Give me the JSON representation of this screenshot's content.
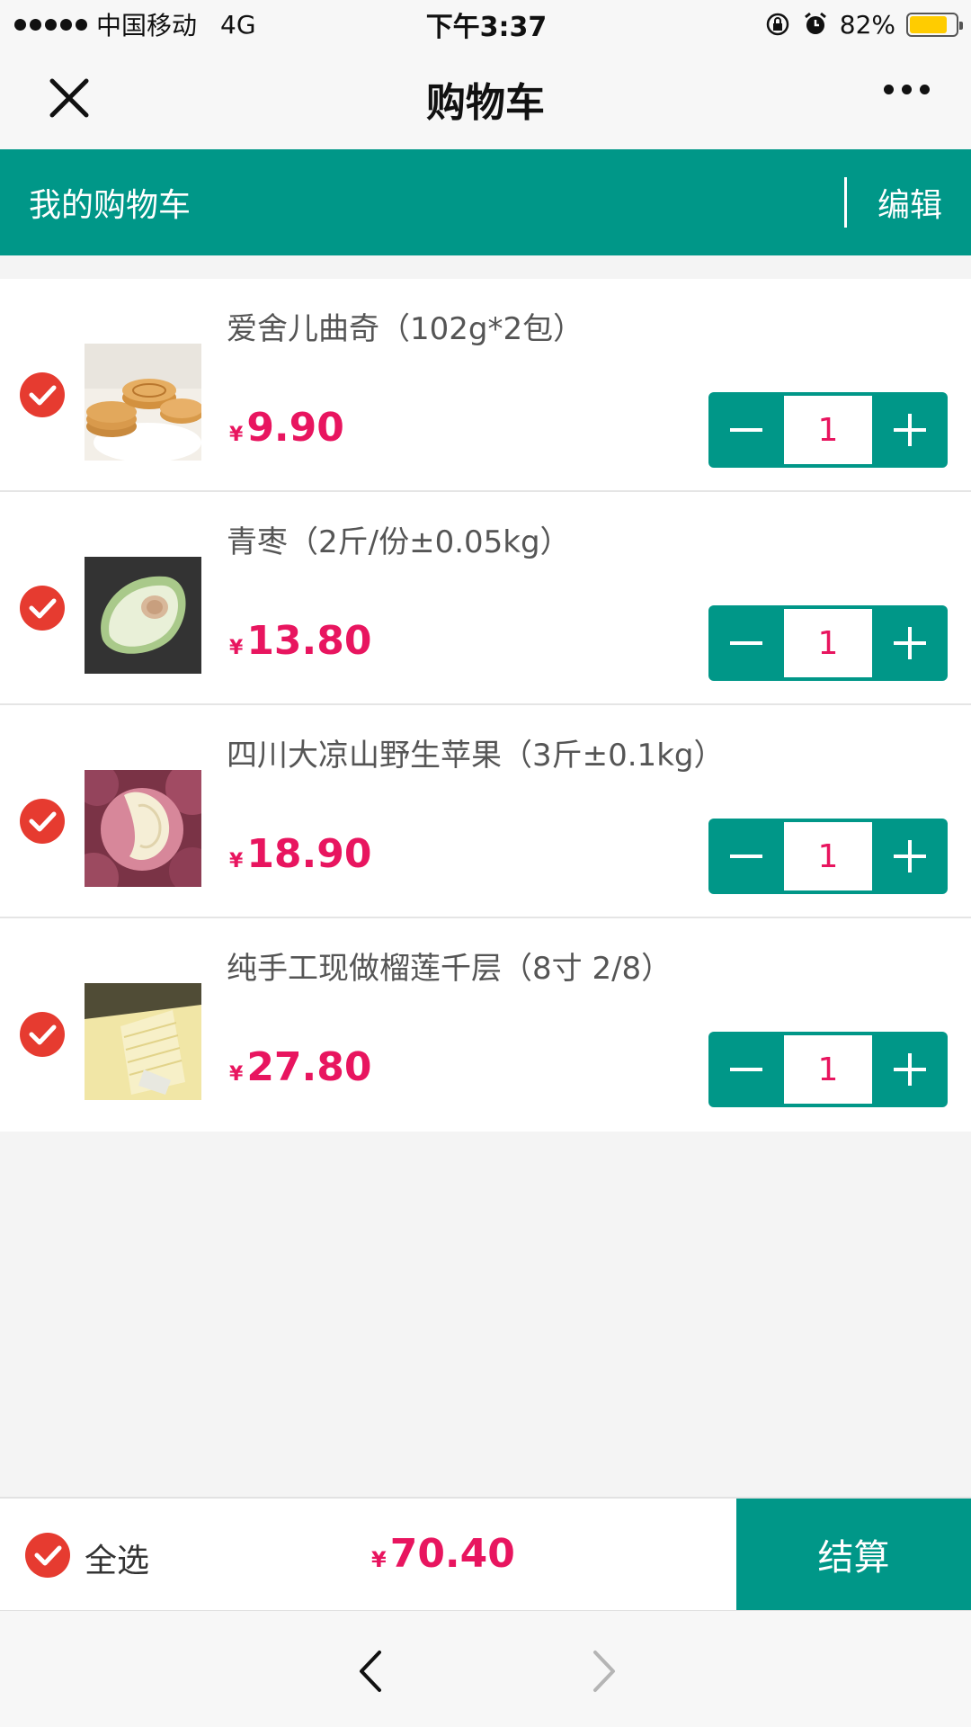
{
  "status_bar": {
    "carrier": "中国移动",
    "network": "4G",
    "time": "下午3:37",
    "battery_percent": "82%",
    "battery_level": 0.82
  },
  "nav": {
    "title": "购物车"
  },
  "cart_header": {
    "title": "我的购物车",
    "edit_label": "编辑"
  },
  "items": [
    {
      "name": "爱舍儿曲奇（102g*2包）",
      "currency": "¥",
      "price": "9.90",
      "quantity": "1",
      "checked": true
    },
    {
      "name": "青枣（2斤/份±0.05kg）",
      "currency": "¥",
      "price": "13.80",
      "quantity": "1",
      "checked": true
    },
    {
      "name": "四川大凉山野生苹果（3斤±0.1kg）",
      "currency": "¥",
      "price": "18.90",
      "quantity": "1",
      "checked": true
    },
    {
      "name": "纯手工现做榴莲千层（8寸 2/8）",
      "currency": "¥",
      "price": "27.80",
      "quantity": "1",
      "checked": true
    }
  ],
  "footer": {
    "select_all_label": "全选",
    "currency": "¥",
    "total": "70.40",
    "checkout_label": "结算"
  },
  "colors": {
    "accent": "#009788",
    "price": "#e8155f",
    "check": "#e63b30"
  }
}
